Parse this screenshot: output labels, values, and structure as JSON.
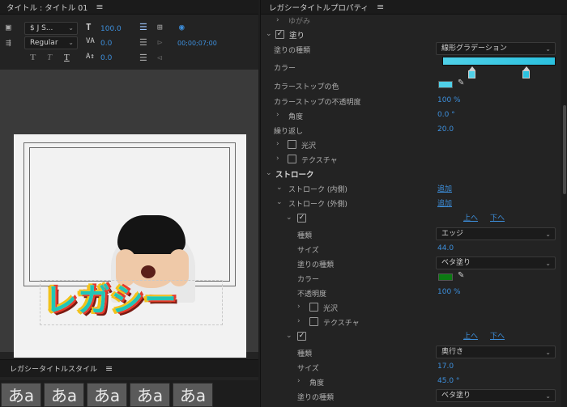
{
  "left_panel": {
    "title": "タイトル : タイトル 01",
    "font_family": "$ J S...",
    "font_style": "Regular",
    "font_size": "100.0",
    "kerning": "0.0",
    "baseline": "0.0",
    "timecode": "00;00;07;00",
    "format_t1": "T",
    "format_t2": "T",
    "format_t3": "T",
    "canvas_text": "レガシー",
    "styles_title": "レガシータイトルスタイル",
    "swatches": [
      "あa",
      "あa",
      "あa",
      "あa",
      "あa"
    ]
  },
  "right_panel": {
    "title": "レガシータイトルプロパティ",
    "top_partial": "ゆがみ",
    "fill_label": "塗り",
    "fill_type_label": "塗りの種類",
    "fill_type_value": "線形グラデーション",
    "color_label": "カラー",
    "stop_color_label": "カラーストップの色",
    "stop_opacity_label": "カラーストップの不透明度",
    "stop_opacity_value": "100 %",
    "angle_label": "角度",
    "angle_value": "0.0 °",
    "repeat_label": "繰り返し",
    "repeat_value": "20.0",
    "gloss_label": "光沢",
    "texture_label": "テクスチャ",
    "stroke_label": "ストローク",
    "inner_stroke_label": "ストローク (内側)",
    "outer_stroke_label": "ストローク (外側)",
    "add_label": "追加",
    "up_label": "上へ",
    "down_label": "下へ",
    "type_label": "種類",
    "size_label": "サイズ",
    "opacity_label": "不透明度",
    "stroke1": {
      "type_value": "エッジ",
      "size_value": "44.0",
      "fill_type_value": "ベタ塗り",
      "opacity_value": "100 %",
      "color": "#0b7a12"
    },
    "stroke2": {
      "type_value": "奥行き",
      "size_value": "17.0",
      "angle_value": "45.0 °",
      "fill_type_value": "ベタ塗り"
    },
    "gradient_color_start": "#4fd0e8",
    "gradient_color_end": "#2bc1df",
    "stop_color": "#4fd0e8"
  }
}
